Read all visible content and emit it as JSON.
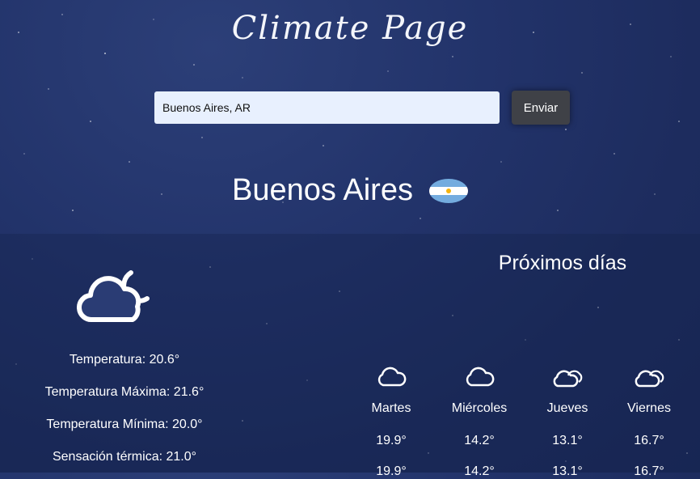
{
  "app_title": "Climate Page",
  "search": {
    "value": "Buenos Aires, AR",
    "button_label": "Enviar"
  },
  "city": {
    "name": "Buenos Aires",
    "flag_icon": "argentina-flag-icon"
  },
  "current": {
    "icon": "cloud-moon-icon",
    "temperature": "Temperatura: 20.6°",
    "max": "Temperatura Máxima: 21.6°",
    "min": "Temperatura Mínima: 20.0°",
    "feels_like": "Sensación térmica: 21.0°"
  },
  "forecast": {
    "title": "Próximos días",
    "days": [
      {
        "name": "Martes",
        "temp": "19.9°",
        "temp2": "19.9°",
        "icon": "cloud-icon"
      },
      {
        "name": "Miércoles",
        "temp": "14.2°",
        "temp2": "14.2°",
        "icon": "cloud-icon"
      },
      {
        "name": "Jueves",
        "temp": "13.1°",
        "temp2": "13.1°",
        "icon": "clouds-icon"
      },
      {
        "name": "Viernes",
        "temp": "16.7°",
        "temp2": "16.7°",
        "icon": "clouds-icon"
      }
    ]
  }
}
